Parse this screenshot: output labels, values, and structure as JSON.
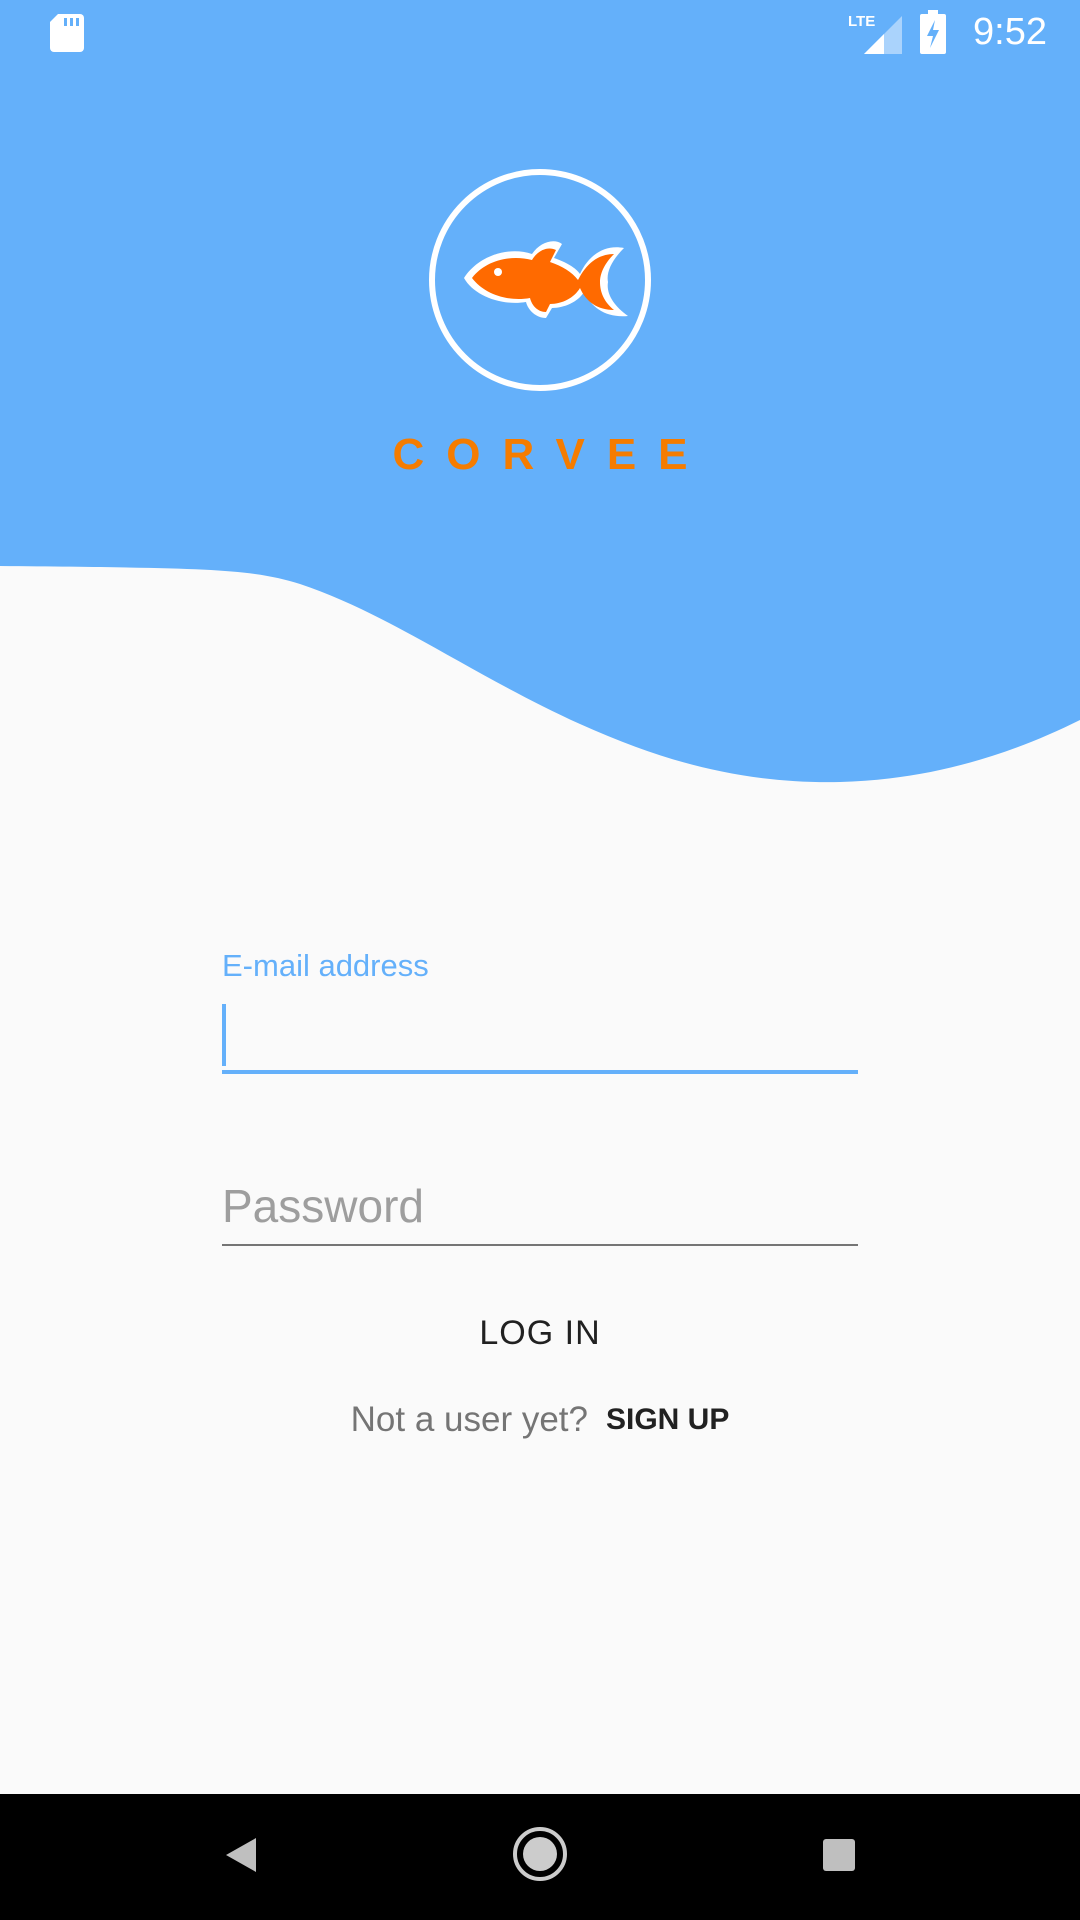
{
  "status_bar": {
    "time": "9:52",
    "network": "LTE",
    "icons": [
      "sd-card-icon",
      "lte-signal-icon",
      "battery-charging-icon"
    ]
  },
  "header": {
    "app_name": "CORVEE",
    "logo_icon": "goldfish-icon"
  },
  "form": {
    "email_label": "E-mail address",
    "email_value": "",
    "password_placeholder": "Password",
    "password_value": "",
    "login_label": "LOG IN",
    "signup_prompt": "Not a user yet?",
    "signup_label": "SIGN UP"
  },
  "nav_bar": {
    "icons": [
      "back-icon",
      "home-icon",
      "recents-icon"
    ]
  },
  "colors": {
    "header_blue": "#64B0FA",
    "brand_orange": "#F57C00",
    "fish_orange": "#FF6A00",
    "background": "#FAFAFA",
    "nav_black": "#000000"
  }
}
